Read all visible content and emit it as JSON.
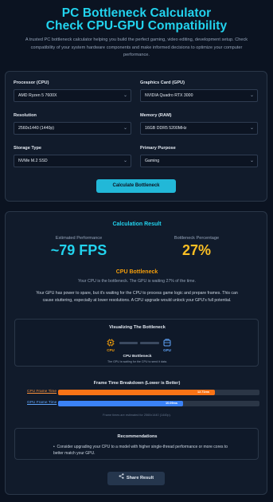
{
  "header": {
    "title_line1": "PC Bottleneck Calculator",
    "title_line2": "Check CPU-GPU Compatibility",
    "description": "A trusted PC bottleneck calculator helping you build the perfect gaming, video editing, development setup. Check compatibility of your system hardware components and make informed decisions to optimize your computer performance."
  },
  "form": {
    "processor": {
      "label": "Processor (CPU)",
      "value": "AMD Ryzen 5 7600X"
    },
    "graphics": {
      "label": "Graphics Card (GPU)",
      "value": "NVIDIA Quadro RTX 3000"
    },
    "resolution": {
      "label": "Resolution",
      "value": "2560x1440 (1440p)"
    },
    "memory": {
      "label": "Memory (RAM)",
      "value": "16GB DDR5 5200MHz"
    },
    "storage": {
      "label": "Storage Type",
      "value": "NVMe M.2 SSD"
    },
    "purpose": {
      "label": "Primary Purpose",
      "value": "Gaming"
    },
    "calculate_label": "Calculate Bottleneck"
  },
  "result": {
    "title": "Calculation Result",
    "perf_label": "Estimated Performance",
    "perf_value": "~79 FPS",
    "bn_pct_label": "Bottleneck Percentage",
    "bn_pct_value": "27%",
    "bn_title": "CPU Bottleneck",
    "bn_sub": "Your CPU is the bottleneck. The GPU is waiting 27% of the time.",
    "bn_desc": "Your GPU has power to spare, but it's waiting for the CPU to process game logic and prepare frames. This can cause stuttering, especially at lower resolutions. A CPU upgrade would unlock your GPU's full potential.",
    "viz": {
      "title": "Visualizing The Bottleneck",
      "cpu_label": "CPU",
      "gpu_label": "GPU",
      "caption_title": "CPU Bottleneck",
      "caption_sub": "The GPU is waiting for the CPU to send it data."
    },
    "frame_time": {
      "title": "Frame Time Breakdown (Lower is Better)",
      "cpu_label": "CPU Frame Time",
      "cpu_value": "12.71ms",
      "cpu_fraction": 0.78,
      "gpu_label": "GPU Frame Time",
      "gpu_value": "10.09ms",
      "gpu_fraction": 0.62,
      "note": "Frame times are estimated for 2560x1440 (1440p)."
    },
    "recommendations": {
      "title": "Recommendations",
      "items": [
        "Consider upgrading your CPU to a model with higher single-thread performance or more cores to better match your GPU."
      ]
    },
    "share_label": "Share Result"
  },
  "colors": {
    "accent": "#22d3ee",
    "warning": "#f59e0b",
    "cpu_bar": "#f97316",
    "gpu_bar": "#3b82f6",
    "gpu_icon": "#60a5fa"
  },
  "icons": [
    "chevron-down-icon",
    "cpu-chip-icon",
    "gpu-icon",
    "share-icon"
  ]
}
